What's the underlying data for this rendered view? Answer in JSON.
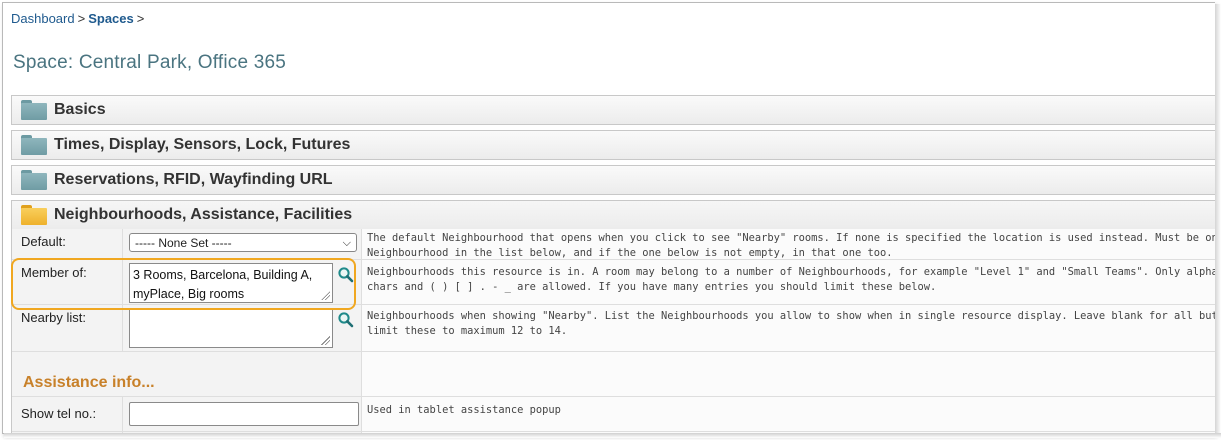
{
  "breadcrumb": {
    "item1": "Dashboard",
    "sep": ">",
    "item2": "Spaces"
  },
  "page_title": "Space: Central Park, Office 365",
  "sections": [
    {
      "label": "Basics",
      "state": "closed"
    },
    {
      "label": "Times, Display, Sensors, Lock, Futures",
      "state": "closed"
    },
    {
      "label": "Reservations, RFID, Wayfinding URL",
      "state": "closed"
    },
    {
      "label": "Neighbourhoods, Assistance, Facilities",
      "state": "open"
    }
  ],
  "fields": {
    "default": {
      "label": "Default:",
      "selected": "----- None Set -----",
      "help": [
        "The default Neighbourhood that opens when you click to see \"Nearby\" rooms. If none is specified the location is used instead. Must be one",
        "Neighbourhood in the list below, and if the one below is not empty, in that one too."
      ]
    },
    "member_of": {
      "label": "Member of:",
      "value_line1": "3 Rooms, Barcelona, Building A,",
      "value_line2": "myPlace, Big rooms",
      "help": [
        "Neighbourhoods this resource is in. A room may belong to a number of Neighbourhoods, for example \"Level 1\" and \"Small Teams\". Only alphanumeric",
        "chars and ( ) [ ] . - _ are allowed. If you have many entries you should limit these below."
      ]
    },
    "nearby_list": {
      "label": "Nearby list:",
      "value": "",
      "help": [
        "Neighbourhoods when showing \"Nearby\". List the Neighbourhoods you allow to show when in single resource display. Leave blank for all but",
        "limit these to maximum 12 to 14."
      ]
    },
    "assistance_heading": "Assistance info...",
    "show_tel": {
      "label": "Show tel no.:",
      "value": "",
      "help": "Used in tablet assistance popup"
    }
  },
  "icons": {
    "lookup": "magnifier-icon",
    "folder_closed": "folder-closed-icon",
    "folder_open": "folder-open-icon"
  },
  "colors": {
    "highlight": "#f0a720",
    "title": "#4a7480",
    "link": "#1f5a8e",
    "assist": "#c8812a"
  }
}
